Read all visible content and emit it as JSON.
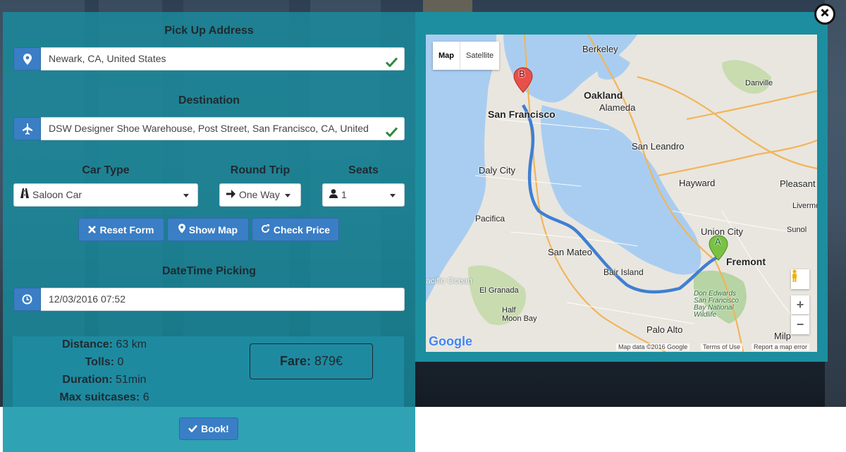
{
  "form": {
    "pickup_label": "Pick Up Address",
    "pickup_value": "Newark, CA, United States",
    "destination_label": "Destination",
    "destination_value": "DSW Designer Shoe Warehouse, Post Street, San Francisco, CA, United",
    "car_type_label": "Car Type",
    "car_type_value": "Saloon Car",
    "round_trip_label": "Round Trip",
    "round_trip_value": "One Way",
    "seats_label": "Seats",
    "seats_value": "1",
    "datetime_label": "DateTime Picking",
    "datetime_value": "12/03/2016 07:52"
  },
  "buttons": {
    "reset": "Reset Form",
    "show_map": "Show Map",
    "check_price": "Check Price",
    "book": "Book!"
  },
  "summary": {
    "distance_label": "Distance:",
    "distance_value": "63 km",
    "tolls_label": "Tolls:",
    "tolls_value": "0",
    "duration_label": "Duration:",
    "duration_value": "51min",
    "suitcases_label": "Max suitcases:",
    "suitcases_value": "6",
    "fare_label": "Fare:",
    "fare_value": "879€"
  },
  "map": {
    "type_map": "Map",
    "type_satellite": "Satellite",
    "zoom_in": "+",
    "zoom_out": "−",
    "marker_a": "A",
    "marker_b": "B",
    "cities": {
      "berkeley": "Berkeley",
      "oakland": "Oakland",
      "alameda": "Alameda",
      "san_francisco": "San Francisco",
      "san_leandro": "San Leandro",
      "danville": "Danville",
      "daly_city": "Daly City",
      "hayward": "Hayward",
      "pleasanton": "Pleasant",
      "pacifica": "Pacifica",
      "union_city": "Union City",
      "livermore": "Livermo",
      "sunol": "Sunol",
      "san_mateo": "San Mateo",
      "fremont": "Fremont",
      "pacific_ocean": "acific Ocean",
      "el_granada": "El Granada",
      "bair_island": "Bair Island",
      "don_edwards": "Don Edwards\nSan Francisco\nBay National\nWildlife",
      "half_moon_bay": "Half\nMoon Bay",
      "palo_alto": "Palo Alto",
      "milpitas": "Milp"
    },
    "attribution_data": "Map data ©2016 Google",
    "attribution_terms": "Terms of Use",
    "attribution_report": "Report a map error",
    "google_logo": "Google"
  },
  "colors": {
    "panel": "#188c9e",
    "button": "#3a7ec5",
    "route": "#3f7fd3",
    "valid_check": "#2e8b3a"
  }
}
